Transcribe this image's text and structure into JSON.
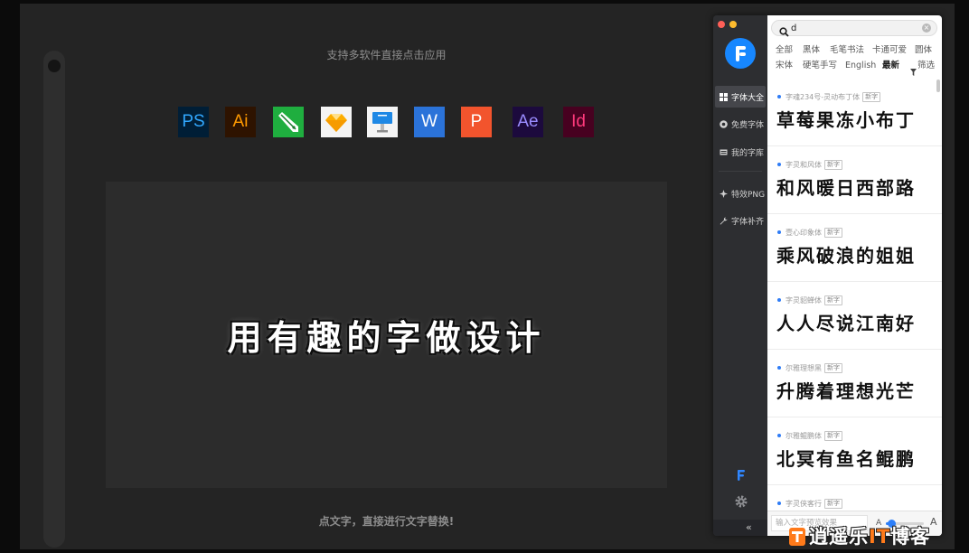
{
  "stage": {
    "top_caption": "支持多软件直接点击应用",
    "bottom_caption": "点文字，直接进行文字替换!",
    "canvas_headline": "用有趣的字做设计",
    "apps": [
      {
        "icon": "photoshop-icon",
        "label": "PS",
        "bg": "#001e36",
        "fg": "#31a8ff"
      },
      {
        "icon": "illustrator-icon",
        "label": "Ai",
        "bg": "#2e1300",
        "fg": "#ff9a00"
      },
      {
        "icon": "pen-tool-app-icon",
        "label": "",
        "bg": "#1fae3f",
        "fg": "#ffffff"
      },
      {
        "icon": "sketch-icon",
        "label": "",
        "bg": "#f4f4f4",
        "fg": "#fdad00"
      },
      {
        "icon": "keynote-icon",
        "label": "",
        "bg": "#f4f4f4",
        "fg": "#1e88e5"
      },
      {
        "icon": "word-icon",
        "label": "W",
        "bg": "#2b73d9",
        "fg": "#ffffff"
      },
      {
        "icon": "powerpoint-icon",
        "label": "P",
        "bg": "#f2542d",
        "fg": "#ffffff"
      },
      {
        "icon": "after-effects-icon",
        "label": "Ae",
        "bg": "#1c0a3d",
        "fg": "#9a8cff"
      },
      {
        "icon": "indesign-icon",
        "label": "Id",
        "bg": "#470120",
        "fg": "#ff3a7c"
      }
    ]
  },
  "font_app": {
    "window_controls": {
      "close": "#ff5f57",
      "minimize": "#febc2e"
    },
    "logo_icon": "font-app-logo-icon",
    "sidebar": {
      "items": [
        {
          "label": "字体大全",
          "icon": "grid-icon",
          "selected": true
        },
        {
          "label": "免费字体",
          "icon": "coin-icon",
          "selected": false
        },
        {
          "label": "我的字库",
          "icon": "library-icon",
          "selected": false
        },
        {
          "label": "特效PNG",
          "icon": "sparkle-icon",
          "selected": false
        },
        {
          "label": "字体补齐",
          "icon": "wrench-icon",
          "selected": false
        }
      ],
      "bottom_icons": [
        "font-app-mini-logo-icon",
        "gear-icon"
      ],
      "collapse_label": "«"
    },
    "search": {
      "value": "d",
      "icon": "search-icon",
      "clear_icon": "clear-icon",
      "clear_label": "×"
    },
    "filters": {
      "row1": [
        "全部",
        "黑体",
        "毛笔书法",
        "卡通可爱",
        "圆体"
      ],
      "row2": [
        "宋体",
        "硬笔手写",
        "English",
        "最新",
        "筛选"
      ],
      "active": "最新",
      "filter_icon": "funnel-icon"
    },
    "fonts": [
      {
        "name": "字魂234号-灵动布丁体",
        "badge": "新字",
        "preview": "草莓果冻小布丁"
      },
      {
        "name": "字灵和风体",
        "badge": "新字",
        "preview": "和风暖日西部路"
      },
      {
        "name": "壹心印象体",
        "badge": "新字",
        "preview": "乘风破浪的姐姐"
      },
      {
        "name": "字灵貂蝉体",
        "badge": "新字",
        "preview": "人人尽说江南好"
      },
      {
        "name": "尔雅理想黑",
        "badge": "新字",
        "preview": "升腾着理想光芒"
      },
      {
        "name": "尔雅鲲鹏体",
        "badge": "新字",
        "preview": "北冥有鱼名鲲鹏"
      },
      {
        "name": "字灵侠客行",
        "badge": "新字"
      }
    ],
    "preview_bar": {
      "placeholder": "输入文字预览效果",
      "size_small_label": "A",
      "size_large_label": "A",
      "size_level": 0.15
    }
  },
  "watermark": {
    "part1": "逍遥乐",
    "part2": "IT",
    "part3": "博客"
  },
  "colors": {
    "accent": "#2d7ff9",
    "logo_blue": "#1787ff",
    "stage_bg": "#242424",
    "canvas_bg": "#2c2c2c"
  }
}
